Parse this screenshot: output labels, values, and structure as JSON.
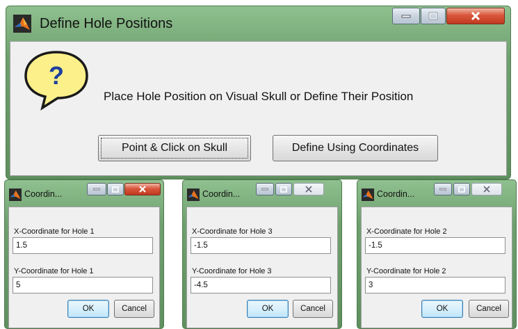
{
  "main_dialog": {
    "title": "Define Hole Positions",
    "prompt": "Place Hole Position on Visual Skull or Define Their Position",
    "point_click_label": "Point & Click on Skull",
    "define_coords_label": "Define Using Coordinates",
    "help_icon": "question-bubble-icon"
  },
  "coord_dialogs": [
    {
      "title": "Coordin...",
      "x_label": "X-Coordinate for Hole 1",
      "x_value": "1.5",
      "y_label": "Y-Coordinate for Hole 1",
      "y_value": "5",
      "ok_label": "OK",
      "cancel_label": "Cancel"
    },
    {
      "title": "Coordin...",
      "x_label": "X-Coordinate for Hole 3",
      "x_value": "-1.5",
      "y_label": "Y-Coordinate for Hole 3",
      "y_value": "-4.5",
      "ok_label": "OK",
      "cancel_label": "Cancel"
    },
    {
      "title": "Coordin...",
      "x_label": "X-Coordinate for Hole 2",
      "x_value": "-1.5",
      "y_label": "Y-Coordinate for Hole 2",
      "y_value": "3",
      "ok_label": "OK",
      "cancel_label": "Cancel"
    }
  ],
  "colors": {
    "window_frame": "#6fa06f",
    "dialog_body": "#f0f0f0",
    "close_button_red": "#c0391f",
    "help_bubble_yellow": "#fbf08a",
    "help_mark_blue": "#1d3f9e"
  }
}
